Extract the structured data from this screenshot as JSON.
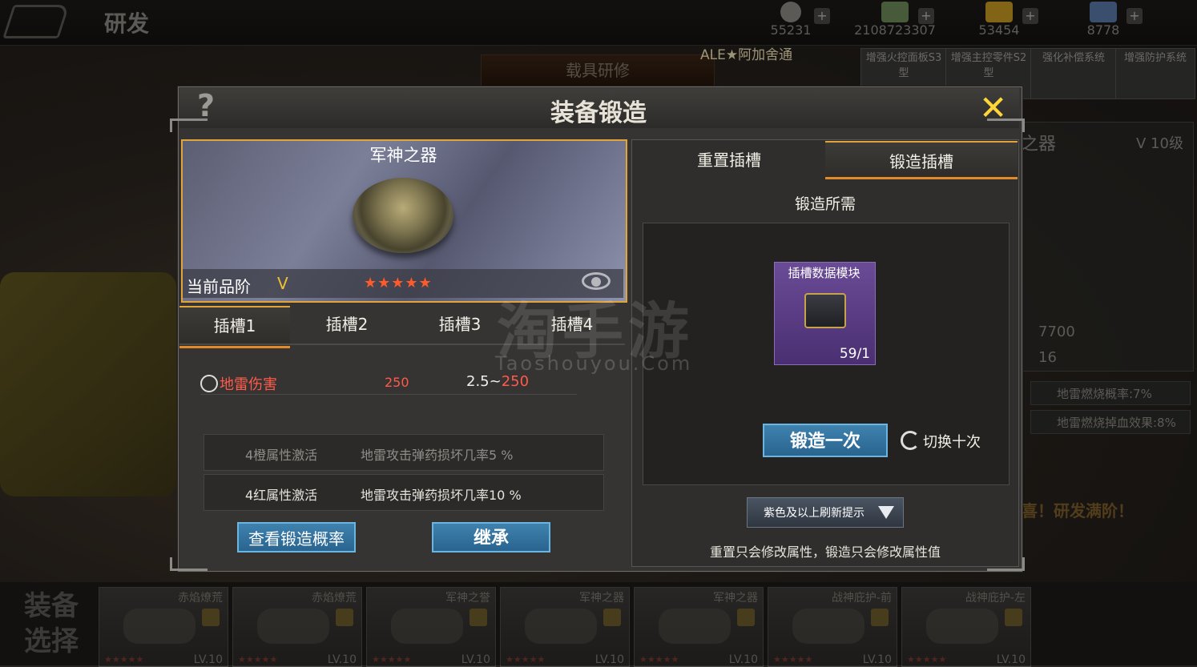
{
  "top": {
    "title": "研发",
    "resources": [
      {
        "value": "55231",
        "icon": "medal-icon"
      },
      {
        "value": "2108723307",
        "icon": "cash-icon"
      },
      {
        "value": "53454",
        "icon": "gold-icon"
      },
      {
        "value": "8778",
        "icon": "jet-icon"
      }
    ],
    "plus": "+",
    "vehicle_tab": "载具研修",
    "player": "ALE★阿加舍通"
  },
  "tech": [
    "增强火控面板S3型",
    "增强主控零件S2型",
    "强化补偿系统",
    "增强防护系统"
  ],
  "side": {
    "title": "军神之器",
    "level": "V 10级",
    "val1": "7700",
    "val2": "16",
    "attr1": "地雷燃烧概率:7%",
    "attr2": "地雷燃烧掉血效果:8%",
    "full": "喜！研发满阶！"
  },
  "dialog": {
    "title": "装备锻造",
    "help": "?",
    "close": "✕",
    "item_name": "军神之器",
    "grade_label": "当前品阶",
    "grade": "V",
    "stars": "★★★★★",
    "slots": [
      "插槽1",
      "插槽2",
      "插槽3",
      "插槽4"
    ],
    "attr": {
      "name": "地雷伤害",
      "value": "250",
      "range_low": "2.5~",
      "range_high": "250"
    },
    "bonuses": [
      {
        "k": "4橙属性激活",
        "v": "地雷攻击弹药损坏几率5 %",
        "color": "#8f8d88"
      },
      {
        "k": "4红属性激活",
        "v": "地雷攻击弹药损坏几率10 %",
        "color": "#e6e3dc"
      }
    ],
    "btn_rate": "查看锻造概率",
    "btn_inherit": "继承",
    "right_tabs": [
      "重置插槽",
      "锻造插槽"
    ],
    "req_title": "锻造所需",
    "material": {
      "name": "插槽数据模块",
      "count": "59/1"
    },
    "btn_forge": "锻造一次",
    "toggle": "切换十次",
    "dropdown": "紫色及以上刷新提示",
    "note": "重置只会修改属性，锻造只会修改属性值"
  },
  "watermark": {
    "cn": "淘手游",
    "en": "Taoshouyou.Com"
  },
  "shelf": {
    "label": "装备选择",
    "cards": [
      {
        "name": "赤焰燎荒",
        "lv": "LV.10",
        "stars": "★★★★★"
      },
      {
        "name": "赤焰燎荒",
        "lv": "LV.10",
        "stars": "★★★★★"
      },
      {
        "name": "军神之誉",
        "lv": "LV.10",
        "stars": "★★★★★"
      },
      {
        "name": "军神之器",
        "lv": "LV.10",
        "stars": "★★★★★"
      },
      {
        "name": "军神之器",
        "lv": "LV.10",
        "stars": "★★★★★"
      },
      {
        "name": "战神庇护-前",
        "lv": "LV.10",
        "stars": "★★★★★"
      },
      {
        "name": "战神庇护-左",
        "lv": "LV.10",
        "stars": "★★★★★"
      }
    ]
  }
}
